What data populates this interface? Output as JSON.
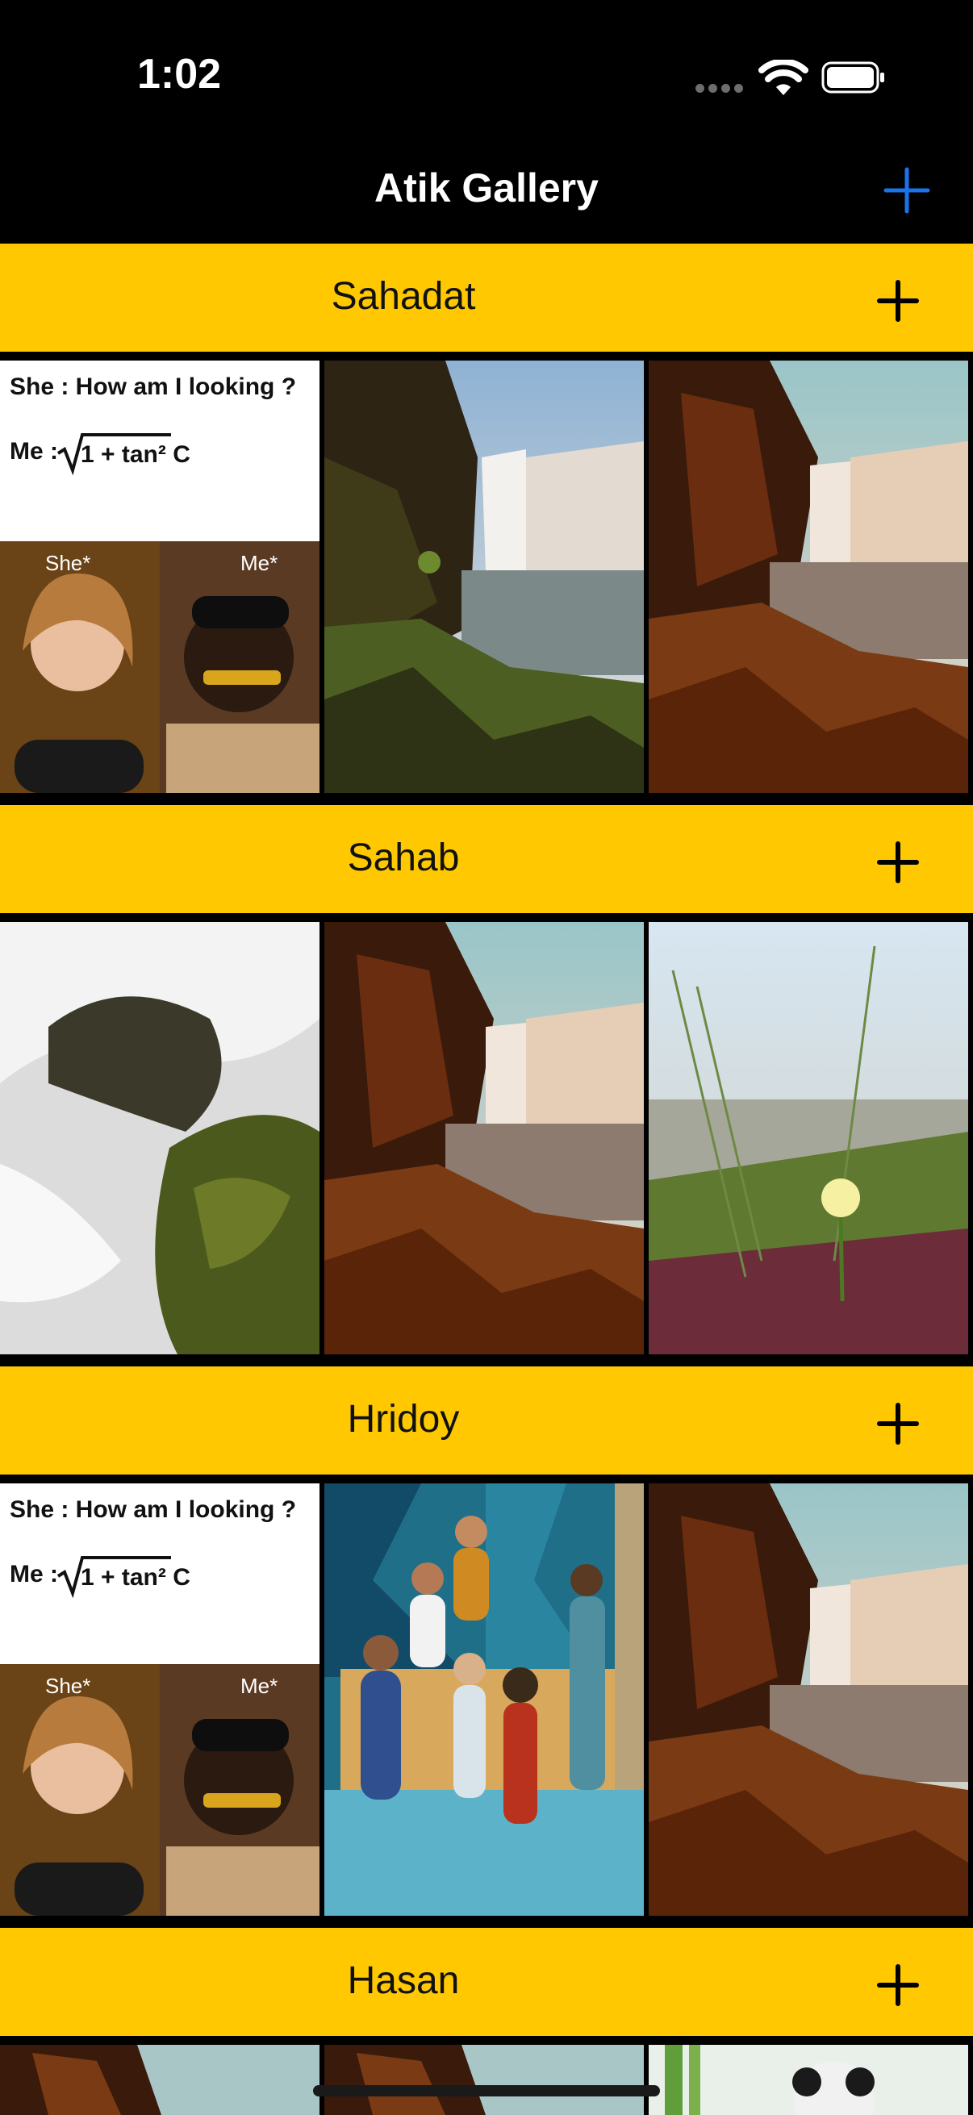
{
  "status_bar": {
    "time": "1:02"
  },
  "nav": {
    "title": "Atik Gallery"
  },
  "sections": [
    {
      "name": "Sahadat",
      "images": [
        "meme-she-how-am-i-looking",
        "waterfall-cliff-green",
        "waterfall-cliff-warm"
      ]
    },
    {
      "name": "Sahab",
      "images": [
        "waterfall-mossy-rocks",
        "waterfall-cliff-warm",
        "yellow-flower-grass"
      ]
    },
    {
      "name": "Hridoy",
      "images": [
        "meme-she-how-am-i-looking",
        "group-people-office",
        "waterfall-cliff-warm"
      ]
    },
    {
      "name": "Hasan",
      "images": [
        "waterfall-cliff-warm",
        "waterfall-cliff-warm",
        "panda-bamboo"
      ]
    }
  ],
  "meme": {
    "line1": "She : How am I looking ?",
    "line2": "Me :",
    "formula": "1 + tan² C",
    "she_tag": "She*",
    "me_tag": "Me*"
  },
  "colors": {
    "header": "#ffc800",
    "accent": "#1a73e8",
    "background": "#000000"
  }
}
